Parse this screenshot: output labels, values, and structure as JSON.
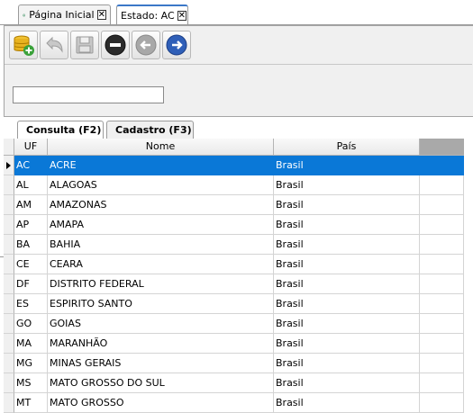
{
  "doc_tabs": [
    {
      "label": "Página Inicial",
      "icon": "home-icon"
    },
    {
      "label": "Estado: AC",
      "icon": null
    }
  ],
  "toolbar": {
    "buttons": [
      {
        "name": "new-record-button",
        "icon": "database-add-icon"
      },
      {
        "name": "undo-button",
        "icon": "undo-icon"
      },
      {
        "name": "save-button",
        "icon": "save-icon"
      },
      {
        "name": "delete-button",
        "icon": "minus-circle-icon"
      },
      {
        "name": "previous-button",
        "icon": "arrow-left-circle-icon"
      },
      {
        "name": "next-button",
        "icon": "arrow-right-circle-icon"
      }
    ]
  },
  "search": {
    "value": "",
    "placeholder": ""
  },
  "page_tabs": [
    {
      "label": "Consulta (F2)",
      "icon": "search-icon"
    },
    {
      "label": "Cadastro (F3)",
      "icon": "pencil-icon"
    }
  ],
  "grid": {
    "columns": [
      "UF",
      "Nome",
      "País"
    ],
    "selected_index": 0,
    "rows": [
      {
        "uf": "AC",
        "nome": "ACRE",
        "pais": "Brasil"
      },
      {
        "uf": "AL",
        "nome": "ALAGOAS",
        "pais": "Brasil"
      },
      {
        "uf": "AM",
        "nome": "AMAZONAS",
        "pais": "Brasil"
      },
      {
        "uf": "AP",
        "nome": "AMAPA",
        "pais": "Brasil"
      },
      {
        "uf": "BA",
        "nome": "BAHIA",
        "pais": "Brasil"
      },
      {
        "uf": "CE",
        "nome": "CEARA",
        "pais": "Brasil"
      },
      {
        "uf": "DF",
        "nome": "DISTRITO FEDERAL",
        "pais": "Brasil"
      },
      {
        "uf": "ES",
        "nome": "ESPIRITO SANTO",
        "pais": "Brasil"
      },
      {
        "uf": "GO",
        "nome": "GOIAS",
        "pais": "Brasil"
      },
      {
        "uf": "MA",
        "nome": "MARANHÃO",
        "pais": "Brasil"
      },
      {
        "uf": "MG",
        "nome": "MINAS GERAIS",
        "pais": "Brasil"
      },
      {
        "uf": "MS",
        "nome": "MATO GROSSO DO SUL",
        "pais": "Brasil"
      },
      {
        "uf": "MT",
        "nome": "MATO GROSSO",
        "pais": "Brasil"
      }
    ]
  },
  "colors": {
    "selection": "#0a78d7",
    "active_tab_accent": "#3b78c8"
  }
}
